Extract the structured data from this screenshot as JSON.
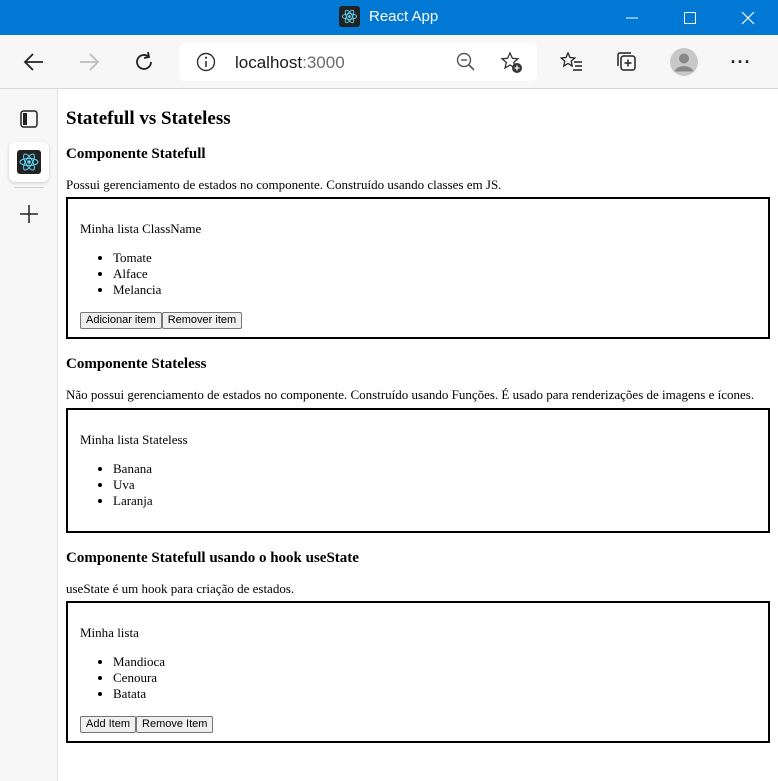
{
  "window": {
    "title": "React App",
    "minimize": "—",
    "maximize": "☐",
    "close": "✕"
  },
  "toolbar": {
    "url_host": "localhost",
    "url_port": ":3000",
    "more": "···"
  },
  "page": {
    "title": "Statefull vs Stateless",
    "sections": [
      {
        "heading": "Componente Statefull",
        "description": "Possui gerenciamento de estados no componente. Construído usando classes em JS.",
        "list_title": "Minha lista ClassName",
        "items": [
          "Tomate",
          "Alface",
          "Melancia"
        ],
        "buttons": [
          "Adicionar item",
          "Remover item"
        ]
      },
      {
        "heading": "Componente Stateless",
        "description": "Não possui gerenciamento de estados no componente. Construído usando Funções. É usado para renderizações de imagens e ícones.",
        "list_title": "Minha lista Stateless",
        "items": [
          "Banana",
          "Uva",
          "Laranja"
        ]
      },
      {
        "heading": "Componente Statefull usando o hook useState",
        "description": "useState é um hook para criação de estados.",
        "list_title": "Minha lista",
        "items": [
          "Mandioca",
          "Cenoura",
          "Batata"
        ],
        "buttons": [
          "Add Item",
          "Remove Item"
        ]
      }
    ]
  },
  "colors": {
    "titlebar": "#0078d4",
    "toolbar": "#f7f7f7",
    "react": "#61dafb"
  }
}
